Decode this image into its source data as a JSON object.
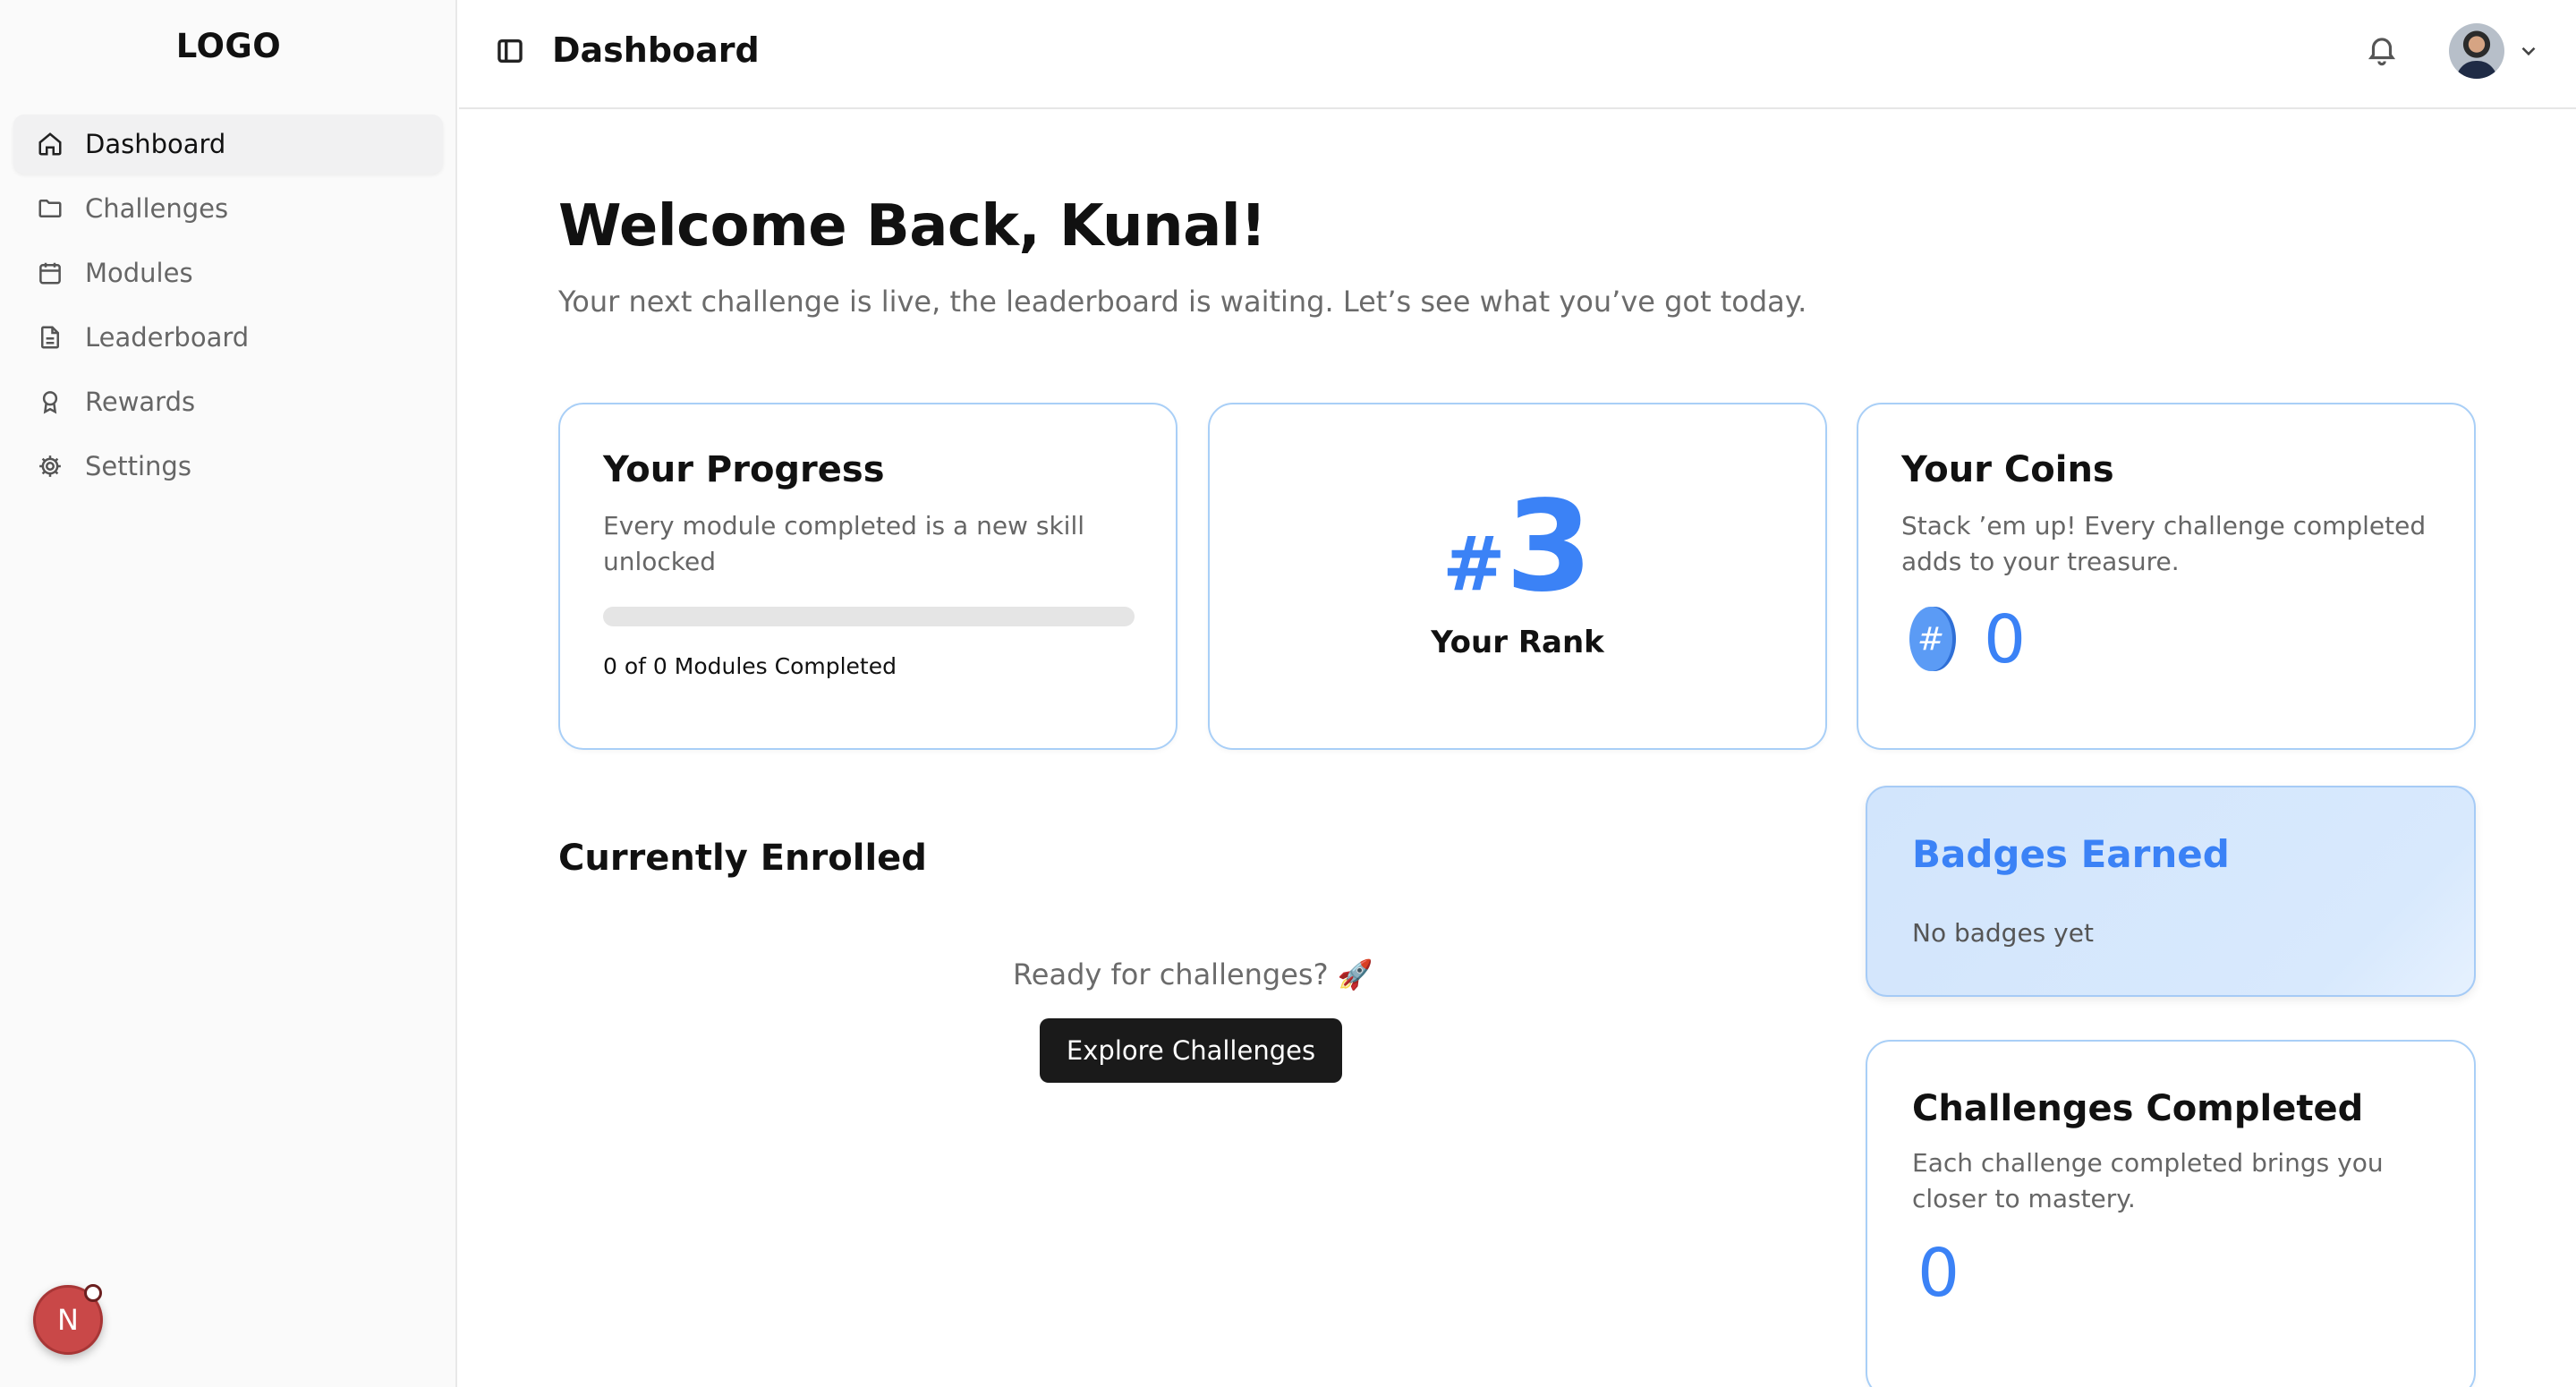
{
  "sidebar": {
    "logo": "LOGO",
    "items": [
      {
        "label": "Dashboard",
        "icon": "home-icon",
        "active": true
      },
      {
        "label": "Challenges",
        "icon": "folder-icon",
        "active": false
      },
      {
        "label": "Modules",
        "icon": "calendar-icon",
        "active": false
      },
      {
        "label": "Leaderboard",
        "icon": "document-icon",
        "active": false
      },
      {
        "label": "Rewards",
        "icon": "award-icon",
        "active": false
      },
      {
        "label": "Settings",
        "icon": "gear-icon",
        "active": false
      }
    ],
    "user_initial": "N"
  },
  "header": {
    "title": "Dashboard",
    "icons": [
      "sidebar-toggle-icon",
      "bell-icon",
      "chevron-down-icon"
    ]
  },
  "main": {
    "welcome": "Welcome Back, Kunal!",
    "subtitle": "Your next challenge is live, the leaderboard is waiting. Let’s see what you’ve got today."
  },
  "progress_card": {
    "title": "Your Progress",
    "description": "Every module completed is a new skill unlocked",
    "progress_fraction": 0,
    "status_text": "0 of 0 Modules Completed"
  },
  "rank_card": {
    "hash": "#",
    "rank": "3",
    "label": "Your Rank"
  },
  "coins_card": {
    "title": "Your Coins",
    "description": "Stack ’em up! Every challenge completed adds to your treasure.",
    "coin_icon_glyph": "#",
    "value": "0"
  },
  "enrolled": {
    "title": "Currently Enrolled",
    "empty_text": "Ready for challenges? 🚀",
    "button_label": "Explore Challenges"
  },
  "badges_card": {
    "title": "Badges Earned",
    "empty_text": "No badges yet"
  },
  "completed_card": {
    "title": "Challenges Completed",
    "description": "Each challenge completed brings you closer to mastery.",
    "value": "0"
  },
  "colors": {
    "accent": "#3b82f6",
    "card_border": "#a9cff7",
    "badges_bg": "#d2e5fc",
    "button_bg": "#1a1a1a",
    "avatar_red": "#c94848"
  }
}
